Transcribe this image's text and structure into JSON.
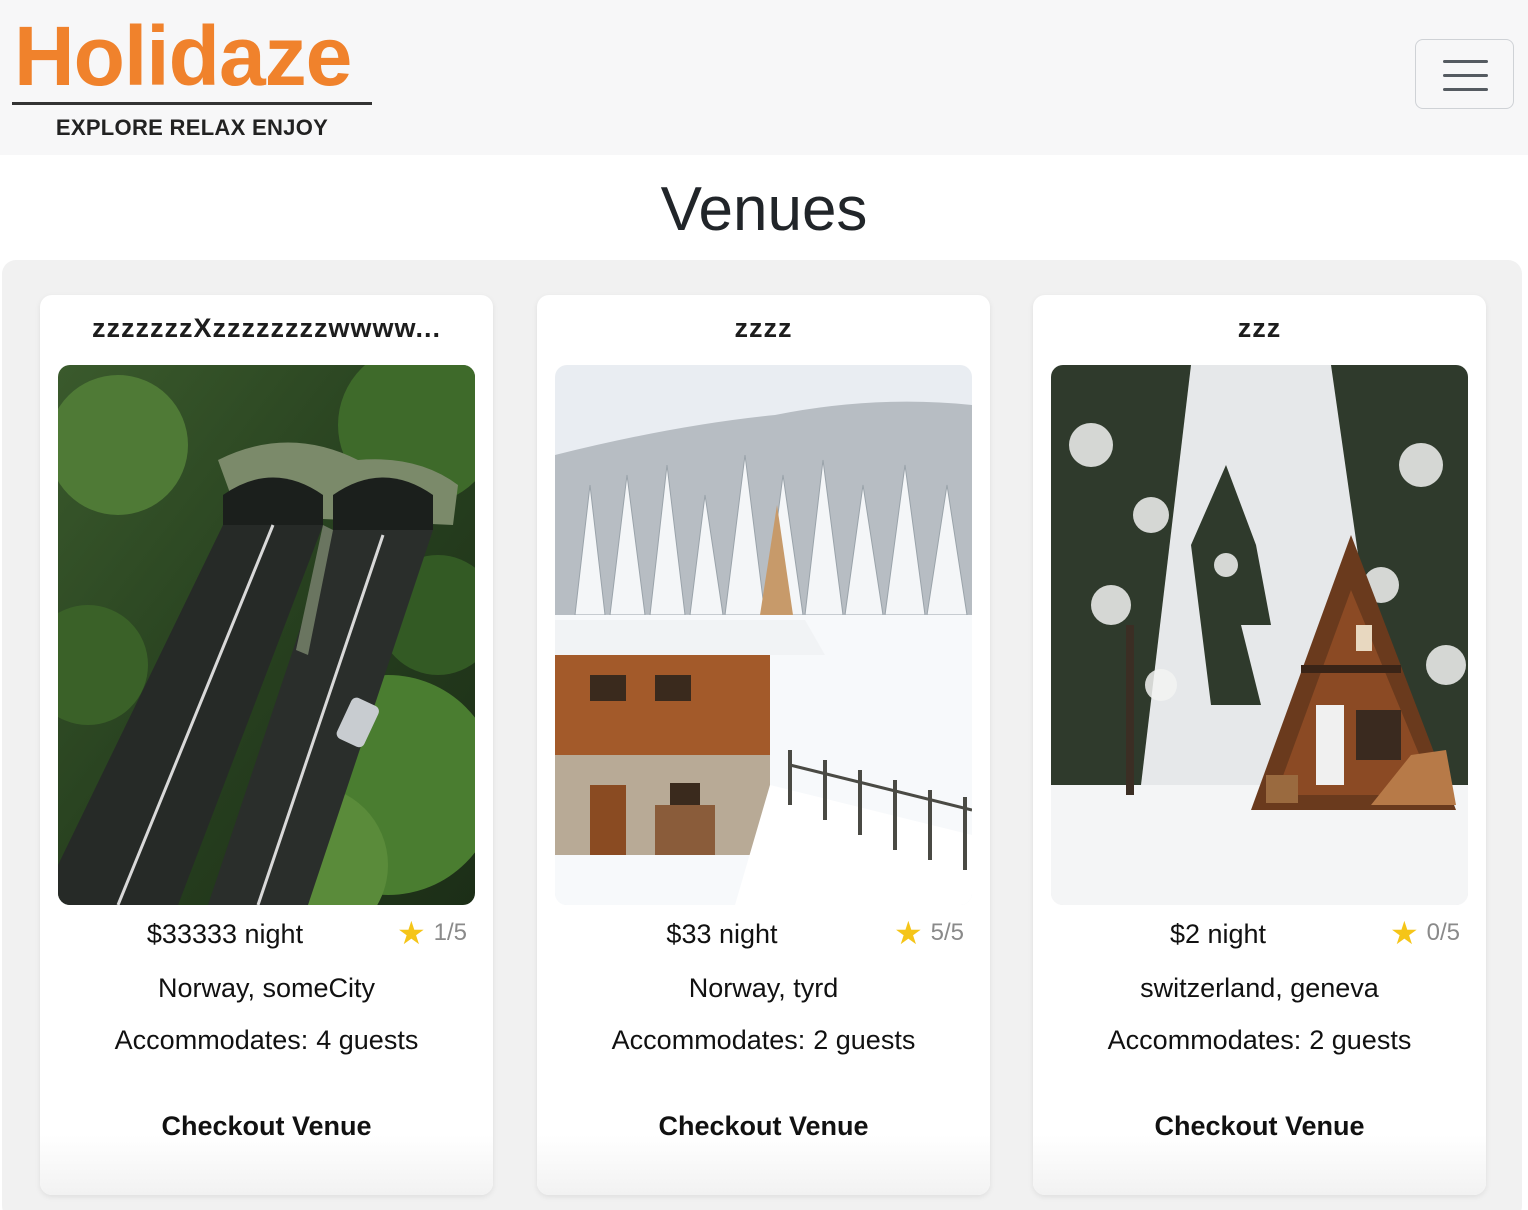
{
  "brand": {
    "name": "Holidaze",
    "tagline": "EXPLORE RELAX ENJOY",
    "color": "#f0822c"
  },
  "nav": {
    "menu_icon": "hamburger-menu-icon"
  },
  "page": {
    "title": "Venues"
  },
  "venues": [
    {
      "name": "zzzzzzzXzzzzzzzzwwww...",
      "image": "aerial-forest-road-tunnel",
      "price": "$33333",
      "price_unit": "night",
      "rating": "1/5",
      "location": "Norway, someCity",
      "guests_label": "Accommodates:",
      "guests": "4 guests",
      "cta": "Checkout Venue"
    },
    {
      "name": "zzzz",
      "image": "snowy-chalet-forest",
      "price": "$33",
      "price_unit": "night",
      "rating": "5/5",
      "location": "Norway, tyrd",
      "guests_label": "Accommodates:",
      "guests": "2 guests",
      "cta": "Checkout Venue"
    },
    {
      "name": "zzz",
      "image": "a-frame-cabin-snow",
      "price": "$2",
      "price_unit": "night",
      "rating": "0/5",
      "location": "switzerland, geneva",
      "guests_label": "Accommodates:",
      "guests": "2 guests",
      "cta": "Checkout Venue"
    }
  ],
  "icons": {
    "rating": "star-icon",
    "rating_color": "#f5c518"
  }
}
